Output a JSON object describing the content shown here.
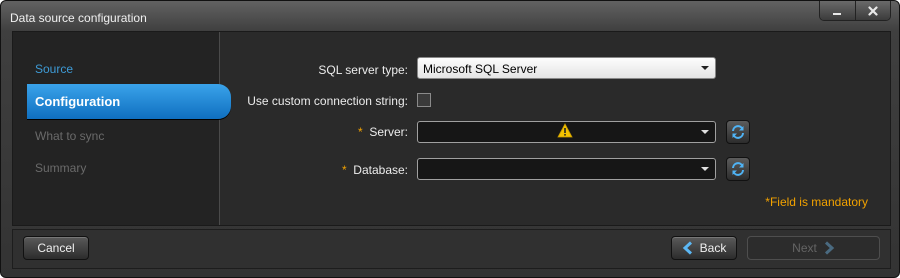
{
  "window": {
    "title": "Data source configuration"
  },
  "steps": [
    {
      "label": "Source",
      "state": "done"
    },
    {
      "label": "Configuration",
      "state": "active"
    },
    {
      "label": "What to sync",
      "state": "pending"
    },
    {
      "label": "Summary",
      "state": "pending"
    }
  ],
  "form": {
    "sql_server_type_label": "SQL server type:",
    "sql_server_type_value": "Microsoft SQL Server",
    "custom_conn_label": "Use custom connection string:",
    "custom_conn_checked": false,
    "required_marker": "*",
    "server_label": "Server:",
    "server_value": "",
    "database_label": "Database:",
    "database_value": "",
    "mandatory_note": "*Field is mandatory"
  },
  "footer": {
    "cancel_label": "Cancel",
    "back_label": "Back",
    "next_label": "Next"
  },
  "icons": {
    "minimize": "minimize-icon",
    "close": "close-icon",
    "refresh": "refresh-icon",
    "warning": "warning-icon",
    "back": "chevron-left-icon",
    "next": "chevron-right-icon"
  },
  "colors": {
    "accent": "#1a80cf",
    "required": "#f2a200",
    "link": "#3e9bd6"
  }
}
